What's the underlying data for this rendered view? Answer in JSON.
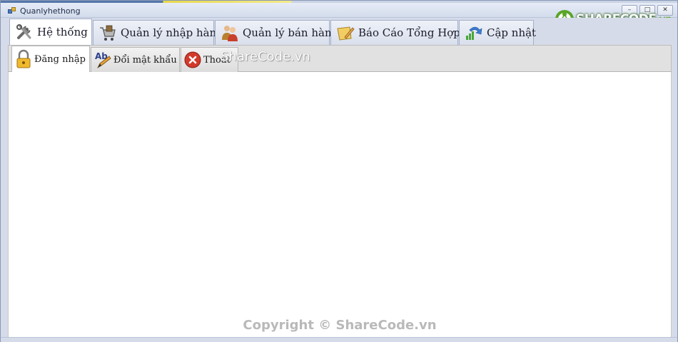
{
  "window": {
    "title": "Quanlyhethong"
  },
  "logo": {
    "brand": "SHARECODE",
    "suffix": ".vn"
  },
  "window_controls": {
    "minimize": "–",
    "maximize": "□",
    "close": "✕"
  },
  "menu_tabs": [
    {
      "label": "Hệ thống",
      "icon": "tools-icon",
      "active": true
    },
    {
      "label": "Quản lý nhập hàng",
      "icon": "cart-icon",
      "active": false
    },
    {
      "label": "Quản lý bán hàng",
      "icon": "people-icon",
      "active": false
    },
    {
      "label": "Báo Cáo Tổng Hợp",
      "icon": "report-icon",
      "active": false
    },
    {
      "label": "Cập nhật",
      "icon": "update-chart-icon",
      "active": false
    }
  ],
  "sub_tabs": [
    {
      "label": "Đăng nhập",
      "icon": "padlock-icon",
      "active": true
    },
    {
      "label": "Đổi mật khẩu",
      "icon": "ab-pencil-icon",
      "active": false
    },
    {
      "label": "Thoát",
      "icon": "red-x-icon",
      "active": false
    }
  ],
  "watermark": "ShareCode.vn",
  "copyright": "Copyright © ShareCode.vn",
  "colors": {
    "frame": "#d6dbe9",
    "ribbon": "#e1e1e1",
    "logo_green": "#5aa528",
    "close_red": "#d23a2c"
  }
}
